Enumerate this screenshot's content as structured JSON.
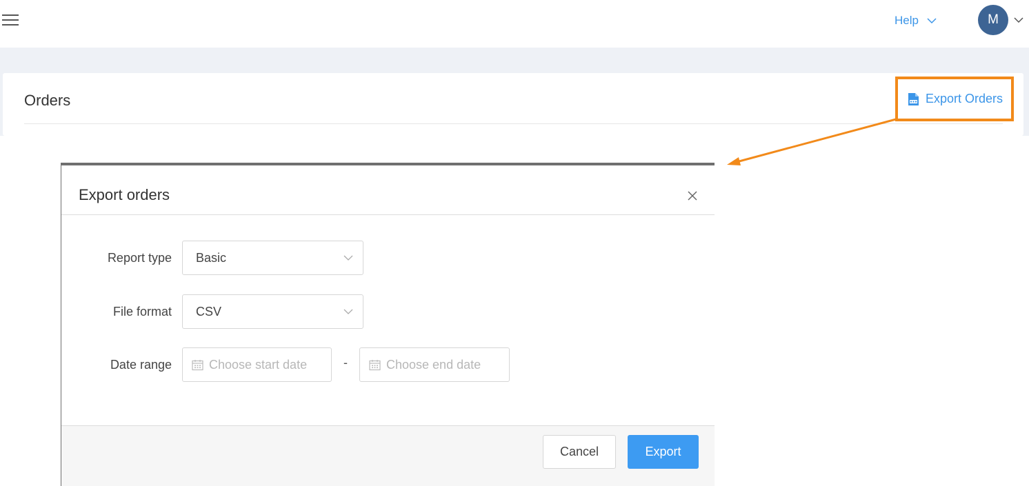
{
  "topbar": {
    "menu_icon": "hamburger-icon",
    "help_label": "Help",
    "avatar_initial": "M"
  },
  "page": {
    "title": "Orders",
    "export_link_label": "Export Orders",
    "export_icon": "csv-file-icon"
  },
  "modal": {
    "title": "Export orders",
    "close_icon": "close-icon",
    "fields": {
      "report_type": {
        "label": "Report type",
        "value": "Basic"
      },
      "file_format": {
        "label": "File format",
        "value": "CSV"
      },
      "date_range": {
        "label": "Date range",
        "start_placeholder": "Choose start date",
        "end_placeholder": "Choose end date",
        "separator": "-"
      }
    },
    "buttons": {
      "cancel": "Cancel",
      "export": "Export"
    }
  },
  "colors": {
    "accent": "#3d9bf2",
    "link": "#3b95e8",
    "highlight": "#f28a1a",
    "avatar_bg": "#3d6494",
    "page_bg": "#eef1f6"
  }
}
